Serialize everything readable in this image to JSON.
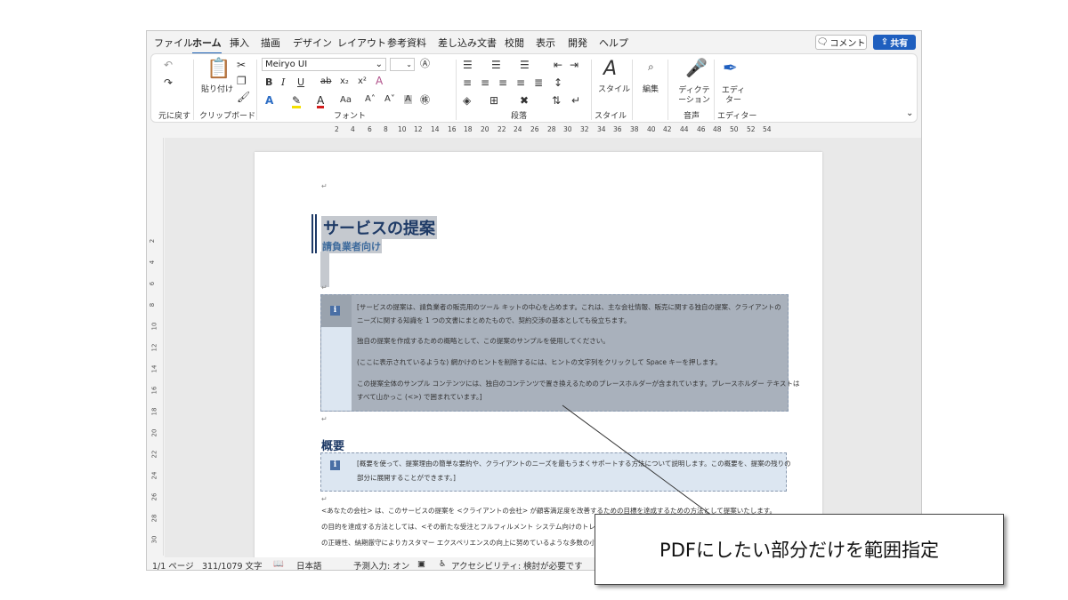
{
  "menu_tabs": [
    "ファイル",
    "ホーム",
    "挿入",
    "描画",
    "デザイン",
    "レイアウト",
    "参考資料",
    "差し込み文書",
    "校閲",
    "表示",
    "開発",
    "ヘルプ"
  ],
  "active_tab": "ホーム",
  "comment_button": "コメント",
  "share_button": "共有",
  "ribbon": {
    "undo_group": "元に戻す",
    "paste_label": "貼り付け",
    "clipboard_group": "クリップボード",
    "font_name": "Meiryo UI",
    "font_group": "フォント",
    "paragraph_group": "段落",
    "style_label": "スタイル",
    "style_group": "スタイル",
    "edit_label": "編集",
    "dictate_label": "ディクテーション",
    "voice_group": "音声",
    "editor_label": "エディター",
    "editor_group": "エディター"
  },
  "ruler_ticks": [
    "2",
    "4",
    "6",
    "8",
    "10",
    "12",
    "14",
    "16",
    "18",
    "20",
    "22",
    "24",
    "26",
    "28",
    "30",
    "32",
    "34",
    "36",
    "38",
    "40",
    "42",
    "44",
    "46",
    "48",
    "50",
    "52",
    "54"
  ],
  "vruler_ticks": [
    "2",
    "4",
    "6",
    "8",
    "10",
    "12",
    "14",
    "16",
    "18",
    "20",
    "22",
    "24",
    "26",
    "28",
    "30"
  ],
  "document": {
    "title": "サービスの提案",
    "subtitle": "請負業者向け",
    "callout1_lines": [
      "[サービスの提案は、請負業者の販売用のツール キットの中心を占めます。これは、主な会社情報、販売に関する独自の提案、クライアントの",
      "ニーズに関する知識を 1 つの文書にまとめたもので、契約交渉の基本としても役立ちます。",
      "独自の提案を作成するための概略として、この提案のサンプルを使用してください。",
      "(ここに表示されているような) 網かけのヒントを削除するには、ヒントの文字列をクリックして Space キーを押します。",
      "この提案全体のサンプル コンテンツには、独自のコンテンツで置き換えるためのプレースホルダーが含まれています。プレースホルダー テキストは",
      "すべて山かっこ (<>) で囲まれています。]"
    ],
    "heading_overview": "概要",
    "callout2_lines": [
      "[概要を使って、提案理由の簡単な要約や、クライアントのニーズを最もうまくサポートする方法について説明します。この概要を、提案の残りの",
      "部分に展開することができます。]"
    ],
    "body_lines": [
      "<あなたの会社> は、このサービスの提案を <クライアントの会社> が顧客満足度を改善するための目標を達成するための方法として提案いたします。",
      "の目的を達成する方法としては、<その新たな受注とフルフィルメント システム向けのトレーニング",
      "の正確性、納期厳守によりカスタマー エクスペリエンスの向上に努めているような多数の小規模な"
    ]
  },
  "status_bar": {
    "page": "1/1 ページ",
    "words": "311/1079 文字",
    "language": "日本語",
    "predict": "予測入力: オン",
    "accessibility": "アクセシビリティ: 検討が必要です"
  },
  "annotation": "PDFにしたい部分だけを範囲指定"
}
